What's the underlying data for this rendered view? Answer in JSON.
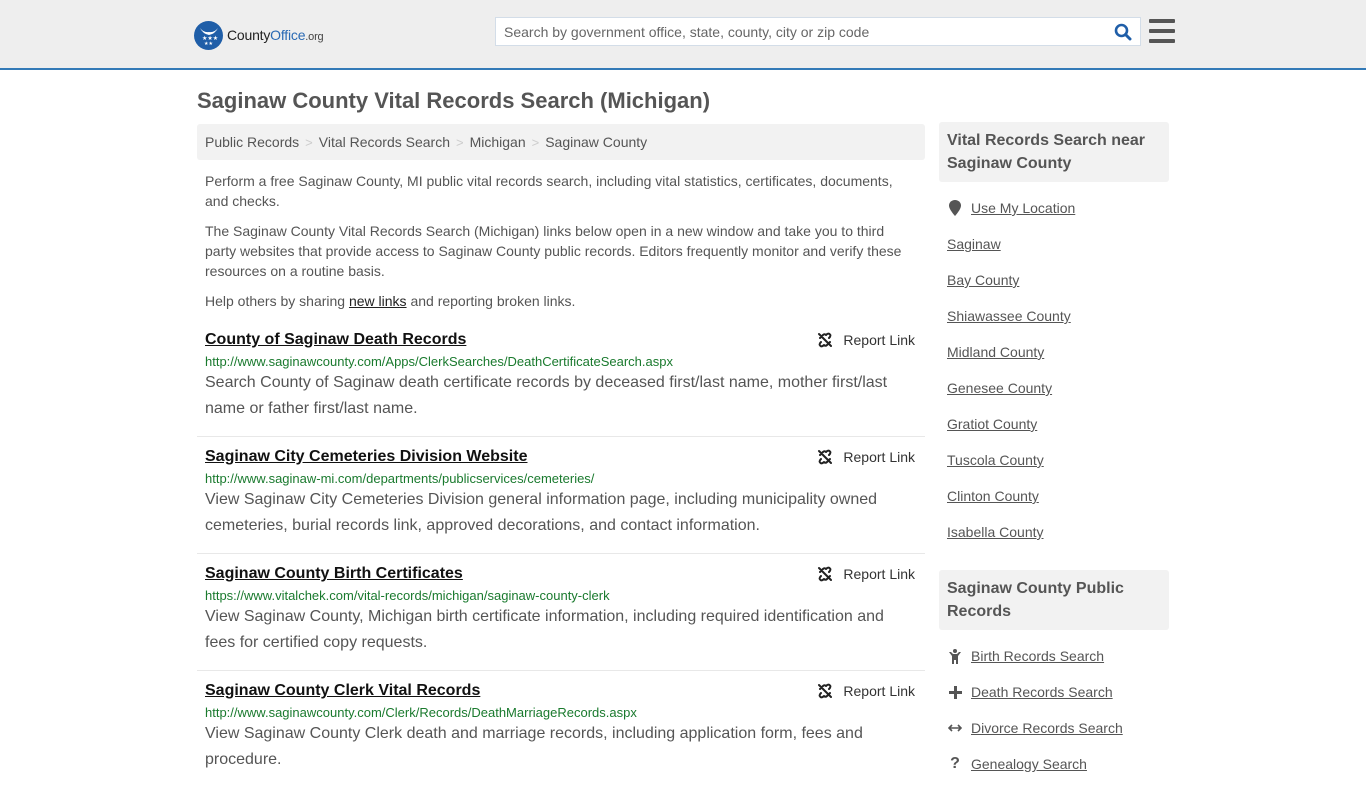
{
  "header": {
    "logo": {
      "name": "County",
      "brand": "Office",
      "tld": ".org"
    },
    "search": {
      "placeholder": "Search by government office, state, county, city or zip code",
      "value": ""
    },
    "colors": {
      "accent": "#337ab7",
      "logo": "#1f5ea8",
      "url_green": "#1a7a2e"
    }
  },
  "page": {
    "title": "Saginaw County Vital Records Search (Michigan)",
    "breadcrumb": [
      "Public Records",
      "Vital Records Search",
      "Michigan",
      "Saginaw County"
    ],
    "intro": {
      "p1": "Perform a free Saginaw County, MI public vital records search, including vital statistics, certificates, documents, and checks.",
      "p2": "The Saginaw County Vital Records Search (Michigan) links below open in a new window and take you to third party websites that provide access to Saginaw County public records. Editors frequently monitor and verify these resources on a routine basis.",
      "p3_before": "Help others by sharing ",
      "p3_link": "new links",
      "p3_after": " and reporting broken links."
    }
  },
  "results": [
    {
      "title": "County of Saginaw Death Records",
      "url": "http://www.saginawcounty.com/Apps/ClerkSearches/DeathCertificateSearch.aspx",
      "description": "Search County of Saginaw death certificate records by deceased first/last name, mother first/last name or father first/last name.",
      "report_label": "Report Link"
    },
    {
      "title": "Saginaw City Cemeteries Division Website",
      "url": "http://www.saginaw-mi.com/departments/publicservices/cemeteries/",
      "description": "View Saginaw City Cemeteries Division general information page, including municipality owned cemeteries, burial records link, approved decorations, and contact information.",
      "report_label": "Report Link"
    },
    {
      "title": "Saginaw County Birth Certificates",
      "url": "https://www.vitalchek.com/vital-records/michigan/saginaw-county-clerk",
      "description": "View Saginaw County, Michigan birth certificate information, including required identification and fees for certified copy requests.",
      "report_label": "Report Link"
    },
    {
      "title": "Saginaw County Clerk Vital Records",
      "url": "http://www.saginawcounty.com/Clerk/Records/DeathMarriageRecords.aspx",
      "description": "View Saginaw County Clerk death and marriage records, including application form, fees and procedure.",
      "report_label": "Report Link"
    }
  ],
  "sidebar": {
    "nearby": {
      "heading": "Vital Records Search near Saginaw County",
      "use_location": "Use My Location",
      "items": [
        "Saginaw",
        "Bay County",
        "Shiawassee County",
        "Midland County",
        "Genesee County",
        "Gratiot County",
        "Tuscola County",
        "Clinton County",
        "Isabella County"
      ]
    },
    "public_records": {
      "heading": "Saginaw County Public Records",
      "items": [
        {
          "label": "Birth Records Search",
          "icon": "child-icon"
        },
        {
          "label": "Death Records Search",
          "icon": "plus-icon"
        },
        {
          "label": "Divorce Records Search",
          "icon": "arrows-horizontal-icon"
        },
        {
          "label": "Genealogy Search",
          "icon": "question-icon"
        }
      ]
    }
  }
}
